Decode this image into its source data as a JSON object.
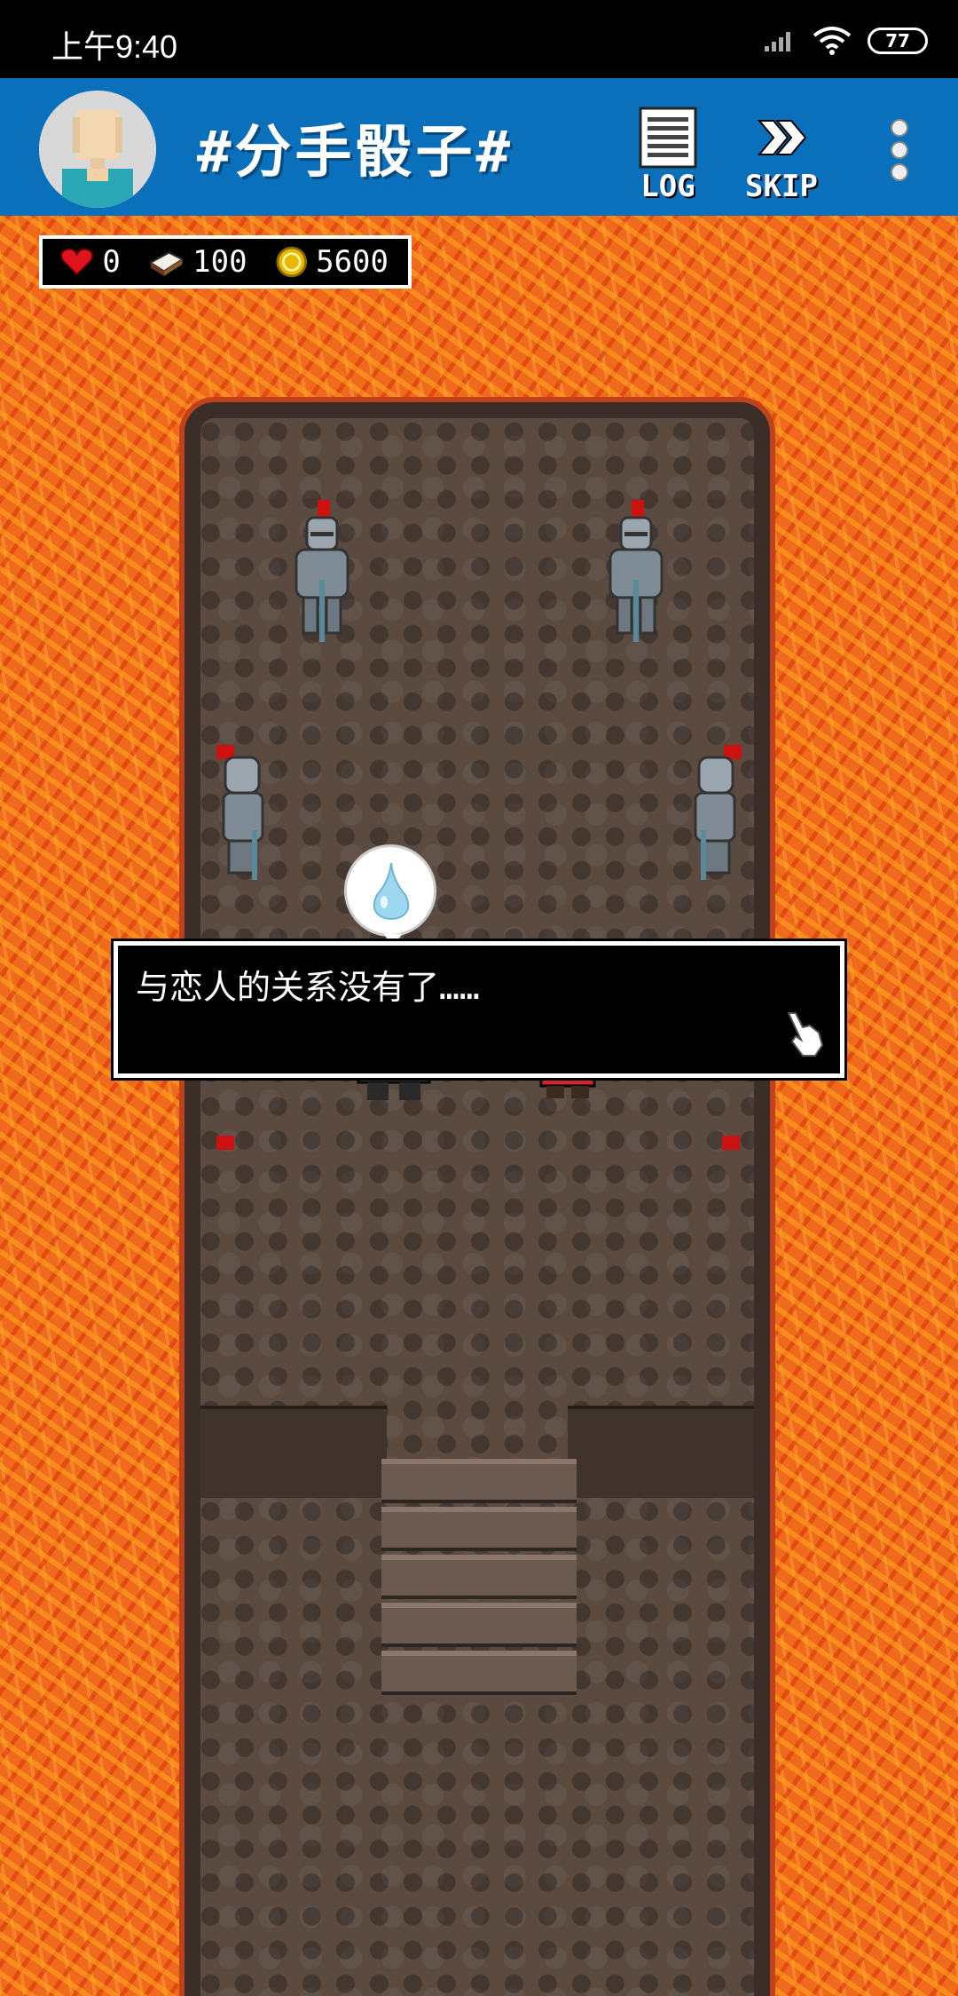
{
  "status_bar": {
    "time": "上午9:40",
    "battery": "77",
    "icons": [
      "signal-icon",
      "wifi-icon",
      "battery-icon"
    ]
  },
  "header": {
    "title": "#分手骰子#",
    "log_label": "LOG",
    "skip_label": "SKIP",
    "icons": [
      "avatar",
      "log-icon",
      "skip-icon",
      "menu-dots-icon"
    ],
    "color": "#0b70bb"
  },
  "hud": {
    "hearts": "0",
    "books": "100",
    "coins": "5600",
    "icons": [
      "heart-icon",
      "book-icon",
      "coin-icon"
    ]
  },
  "scene": {
    "bubble_icon": "teardrop-icon",
    "characters": [
      "hero",
      "girl-red-hood"
    ],
    "knights": 6
  },
  "dialog": {
    "text": "与恋人的关系没有了……",
    "cursor_icon": "pointing-hand-icon"
  }
}
